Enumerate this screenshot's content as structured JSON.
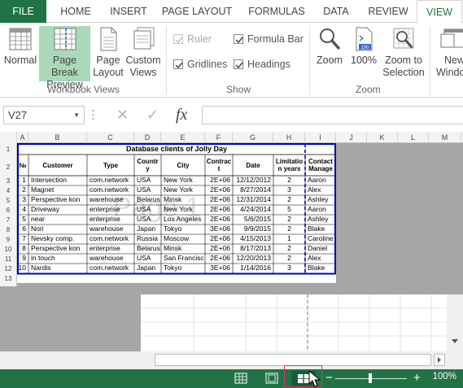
{
  "tabs": [
    "FILE",
    "HOME",
    "INSERT",
    "PAGE LAYOUT",
    "FORMULAS",
    "DATA",
    "REVIEW",
    "VIEW"
  ],
  "ribbon": {
    "workbook_views": {
      "normal": "Normal",
      "page_break_preview_line1": "Page Break",
      "page_break_preview_line2": "Preview",
      "page_layout_line1": "Page",
      "page_layout_line2": "Layout",
      "custom_views_line1": "Custom",
      "custom_views_line2": "Views",
      "group_label": "Workbook Views"
    },
    "show": {
      "ruler": "Ruler",
      "formula_bar": "Formula Bar",
      "gridlines": "Gridlines",
      "headings": "Headings",
      "group_label": "Show"
    },
    "zoom": {
      "zoom": "Zoom",
      "hundred": "100%",
      "hundred_icon_text": "100",
      "zoom_to_selection_line1": "Zoom to",
      "zoom_to_selection_line2": "Selection",
      "group_label": "Zoom"
    },
    "window": {
      "new_window_line1": "New",
      "new_window_line2": "Window"
    }
  },
  "formula_bar": {
    "name_box": "V27",
    "fx": "fx",
    "cancel": "✕",
    "enter": "✓"
  },
  "columns": [
    "A",
    "B",
    "C",
    "D",
    "E",
    "F",
    "G",
    "H",
    "I",
    "J",
    "K",
    "L",
    "M"
  ],
  "rows": [
    "1",
    "2",
    "3",
    "4",
    "5",
    "6",
    "7",
    "8",
    "9",
    "10",
    "11",
    "12",
    "13"
  ],
  "sheet": {
    "title": "Database clients of Jolly Day",
    "watermark": "Page 1",
    "headers": [
      "№",
      "Customer",
      "Type",
      "Country",
      "City",
      "Contract",
      "Date",
      "Limitation years",
      "Contact Manager"
    ],
    "header_display": {
      "country": [
        "Countr",
        "y"
      ],
      "contract": [
        "Contrac",
        "t"
      ],
      "limitation": [
        "Limitatio",
        "n years"
      ],
      "contact": [
        "Contact",
        "Manage"
      ]
    },
    "rows": [
      [
        "1",
        "Intersection",
        "com.network",
        "USA",
        "New York",
        "2E+06",
        "12/12/2012",
        "2",
        "Aaron"
      ],
      [
        "2",
        "Magnet",
        "com.network",
        "USA",
        "New York",
        "2E+06",
        "8/27/2014",
        "3",
        "Alex"
      ],
      [
        "3",
        "Perspective kon",
        "warehouse",
        "Belarus",
        "Minsk",
        "2E+06",
        "12/31/2014",
        "2",
        "Ashley"
      ],
      [
        "4",
        "Driveway",
        "enterprise",
        "USA",
        "New York",
        "2E+06",
        "4/24/2014",
        "5",
        "Aaron"
      ],
      [
        "5",
        "near",
        "enterprise",
        "USA",
        "Los Angeles",
        "2E+06",
        "5/6/2015",
        "2",
        "Ashley"
      ],
      [
        "6",
        "Nori",
        "warehouse",
        "Japan",
        "Tokyo",
        "3E+06",
        "9/9/2015",
        "2",
        "Blake"
      ],
      [
        "7",
        "Nevsky comp.",
        "com.network",
        "Russia",
        "Moscow",
        "2E+06",
        "4/15/2013",
        "1",
        "Caroline"
      ],
      [
        "8",
        "Perspective kon",
        "enterprise",
        "Belarus",
        "Minsk",
        "2E+06",
        "8/17/2013",
        "2",
        "Daniel"
      ],
      [
        "9",
        "in touch",
        "warehouse",
        "USA",
        "San Francisco",
        "2E+06",
        "12/20/2013",
        "2",
        "Alex"
      ],
      [
        "10",
        "Nardis",
        "com.network",
        "Japan",
        "Tokyo",
        "3E+06",
        "1/14/2016",
        "3",
        "Blake"
      ]
    ]
  },
  "status_bar": {
    "zoom_level": "100%",
    "minus": "−",
    "plus": "+"
  },
  "colors": {
    "accent": "#217346",
    "selected_view": "#a9d9b8",
    "print_area_border": "#0000c0",
    "highlight_box": "#e0307a",
    "page_bg": "#a6a6a6"
  }
}
